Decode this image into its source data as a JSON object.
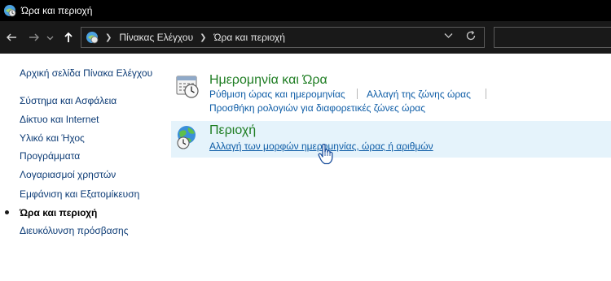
{
  "window": {
    "title": "Ώρα και περιοχή"
  },
  "navbar": {
    "back_icon": "arrow-left",
    "forward_icon": "arrow-right",
    "recent_icon": "chevron-down",
    "up_icon": "arrow-up",
    "breadcrumb": [
      "Πίνακας Ελέγχου",
      "Ώρα και περιοχή"
    ],
    "refresh_icon": "refresh"
  },
  "sidebar": {
    "home_label": "Αρχική σελίδα Πίνακα Ελέγχου",
    "items": [
      {
        "label": "Σύστημα και Ασφάλεια",
        "current": false
      },
      {
        "label": "Δίκτυο και Internet",
        "current": false
      },
      {
        "label": "Υλικό και Ήχος",
        "current": false
      },
      {
        "label": "Προγράμματα",
        "current": false
      },
      {
        "label": "Λογαριασμοί χρηστών",
        "current": false
      },
      {
        "label": "Εμφάνιση και Εξατομίκευση",
        "current": false
      },
      {
        "label": "Ώρα και περιοχή",
        "current": true
      },
      {
        "label": "Διευκόλυνση πρόσβασης",
        "current": false
      }
    ]
  },
  "categories": [
    {
      "title": "Ημερομηνία και Ώρα",
      "icon": "calendar-clock-icon",
      "links": [
        "Ρύθμιση ώρας και ημερομηνίας",
        "Αλλαγή της ζώνης ώρας",
        "Προσθήκη ρολογιών για διαφορετικές ζώνες ώρας"
      ]
    },
    {
      "title": "Περιοχή",
      "icon": "globe-clock-icon",
      "links": [
        "Αλλαγή των μορφών ημερομηνίας, ώρας ή αριθμών"
      ]
    }
  ],
  "colors": {
    "title_green": "#1e7d22",
    "link_blue": "#0d5ca6",
    "hover_background": "#e5f3fb"
  }
}
